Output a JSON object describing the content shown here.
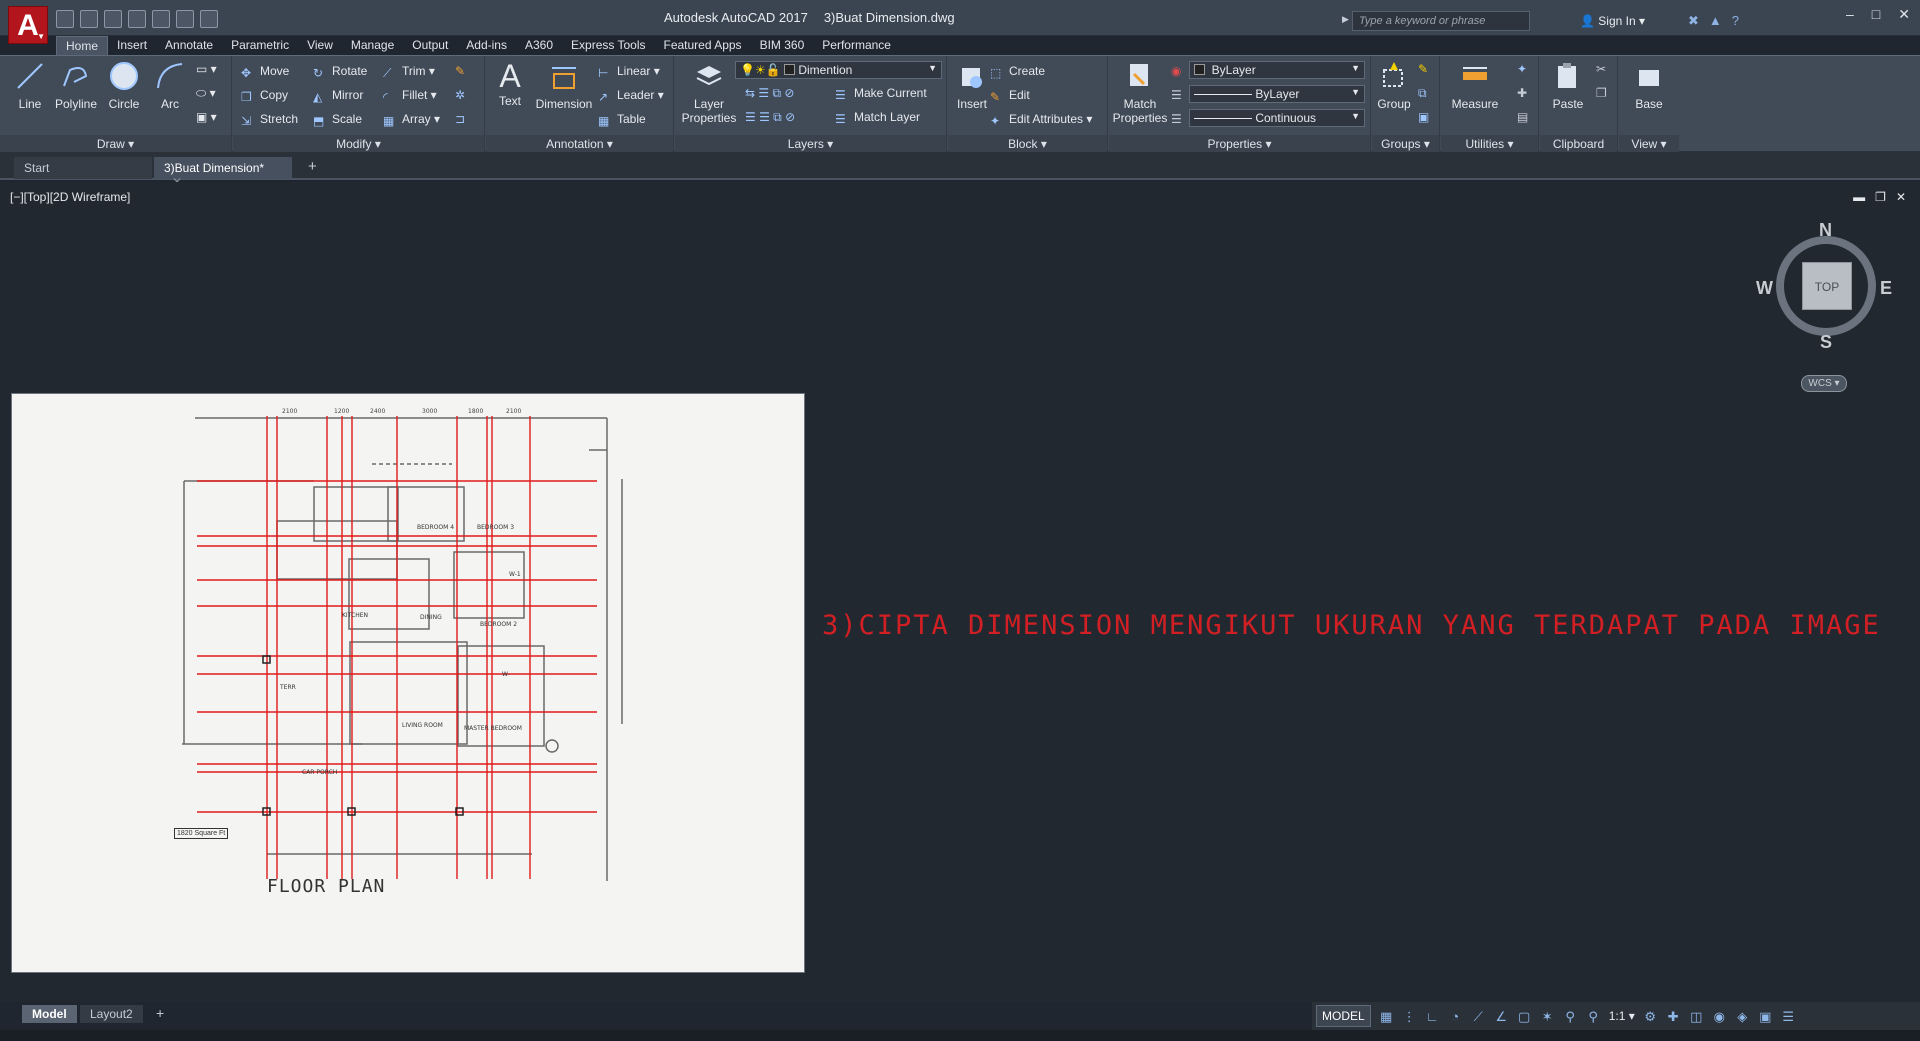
{
  "titlebar": {
    "app_letter": "A",
    "app_name": "Autodesk AutoCAD 2017",
    "document": "3)Buat Dimension.dwg",
    "search_placeholder": "Type a keyword or phrase",
    "sign_in": "Sign In",
    "window_controls": [
      "–",
      "□",
      "✕"
    ]
  },
  "ribbon_tabs": [
    "Home",
    "Insert",
    "Annotate",
    "Parametric",
    "View",
    "Manage",
    "Output",
    "Add-ins",
    "A360",
    "Express Tools",
    "Featured Apps",
    "BIM 360",
    "Performance"
  ],
  "panels": {
    "draw": {
      "title": "Draw",
      "tools": [
        "Line",
        "Polyline",
        "Circle",
        "Arc"
      ]
    },
    "modify": {
      "title": "Modify",
      "tools": [
        "Move",
        "Rotate",
        "Trim",
        "Copy",
        "Mirror",
        "Fillet",
        "Stretch",
        "Scale",
        "Array"
      ]
    },
    "annotation": {
      "title": "Annotation",
      "big": [
        "Text",
        "Dimension"
      ],
      "tools": [
        "Linear",
        "Leader",
        "Table"
      ]
    },
    "layers": {
      "title": "Layers",
      "big": "Layer Properties",
      "layer_name": "Dimention",
      "tools": [
        "Make Current",
        "Match Layer"
      ]
    },
    "block": {
      "title": "Block",
      "big": "Insert",
      "tools": [
        "Create",
        "Edit",
        "Edit Attributes"
      ]
    },
    "properties": {
      "title": "Properties",
      "big": "Match Properties",
      "color": "ByLayer",
      "lineweight": "ByLayer",
      "linetype": "Continuous"
    },
    "groups": {
      "title": "Groups",
      "big": "Group"
    },
    "utilities": {
      "title": "Utilities",
      "big": "Measure"
    },
    "clipboard": {
      "title": "Clipboard",
      "big": "Paste"
    },
    "view": {
      "title": "View",
      "big": "Base"
    }
  },
  "file_tabs": {
    "start": "Start",
    "doc": "3)Buat Dimension*",
    "add": "+"
  },
  "viewport": {
    "label": "[−][Top][2D Wireframe]",
    "instruction": "3)CIPTA DIMENSION MENGIKUT UKURAN YANG TERDAPAT PADA IMAGE",
    "plan_title": "FLOOR PLAN",
    "scale_note": "1820 Square Ft",
    "room_labels": [
      "BEDROOM 4",
      "BEDROOM 3",
      "W-1",
      "KITCHEN",
      "DINING",
      "BEDROOM 2",
      "W-",
      "TERR",
      "LIVING ROOM",
      "MASTER BEDROOM",
      "CAR PORCH"
    ],
    "top_dims": [
      "2100",
      "1200",
      "2400",
      "3000",
      "1800",
      "2100"
    ]
  },
  "viewcube": {
    "n": "N",
    "s": "S",
    "e": "E",
    "w": "W",
    "top": "TOP",
    "wcs": "WCS"
  },
  "layout_tabs": {
    "model": "Model",
    "layout2": "Layout2",
    "add": "+"
  },
  "status": {
    "model": "MODEL",
    "scale": "1:1"
  },
  "colors": {
    "accent": "#b3151c",
    "instruction": "#d21f24",
    "grid_red": "#e01b1b"
  }
}
